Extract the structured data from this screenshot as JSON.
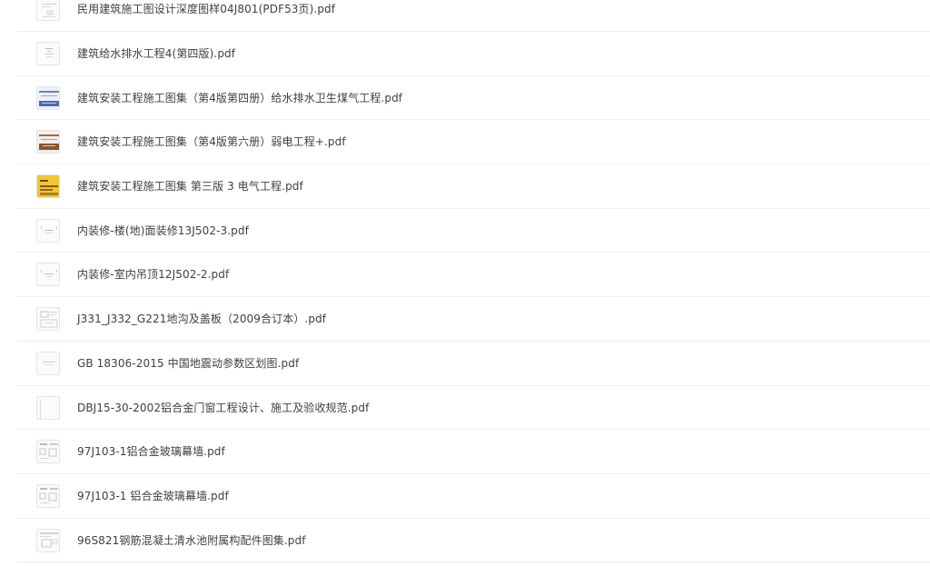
{
  "files": [
    {
      "name": "民用建筑施工图设计深度图样04J801(PDF53页).pdf",
      "thumbnail": "document-thumbnail-icon"
    },
    {
      "name": "建筑给水排水工程4(第四版).pdf",
      "thumbnail": "document-thumbnail-icon"
    },
    {
      "name": "建筑安装工程施工图集（第4版第四册）给水排水卫生煤气工程.pdf",
      "thumbnail": "book-cover-blue-icon"
    },
    {
      "name": "建筑安装工程施工图集（第4版第六册）弱电工程+.pdf",
      "thumbnail": "book-cover-brown-icon"
    },
    {
      "name": "建筑安装工程施工图集 第三版 3 电气工程.pdf",
      "thumbnail": "book-cover-yellow-icon"
    },
    {
      "name": "内装修-楼(地)面装修13J502-3.pdf",
      "thumbnail": "document-thumbnail-icon"
    },
    {
      "name": "内装修-室内吊顶12J502-2.pdf",
      "thumbnail": "document-thumbnail-icon"
    },
    {
      "name": "J331_J332_G221地沟及盖板（2009合订本）.pdf",
      "thumbnail": "drawing-thumbnail-icon"
    },
    {
      "name": "GB 18306-2015 中国地震动参数区划图.pdf",
      "thumbnail": "document-thumbnail-icon"
    },
    {
      "name": "DBJ15-30-2002铝合金门窗工程设计、施工及验收规范.pdf",
      "thumbnail": "blank-page-thumbnail-icon"
    },
    {
      "name": "97J103-1铝合金玻璃幕墙.pdf",
      "thumbnail": "drawing-thumbnail-icon"
    },
    {
      "name": "97J103-1 铝合金玻璃幕墙.pdf",
      "thumbnail": "drawing-thumbnail-icon"
    },
    {
      "name": "96S821钢筋混凝土清水池附属构配件图集.pdf",
      "thumbnail": "drawing-thumbnail-icon"
    }
  ],
  "colors": {
    "text": "#3b3f46",
    "divider": "#eceef1",
    "background": "#ffffff"
  }
}
